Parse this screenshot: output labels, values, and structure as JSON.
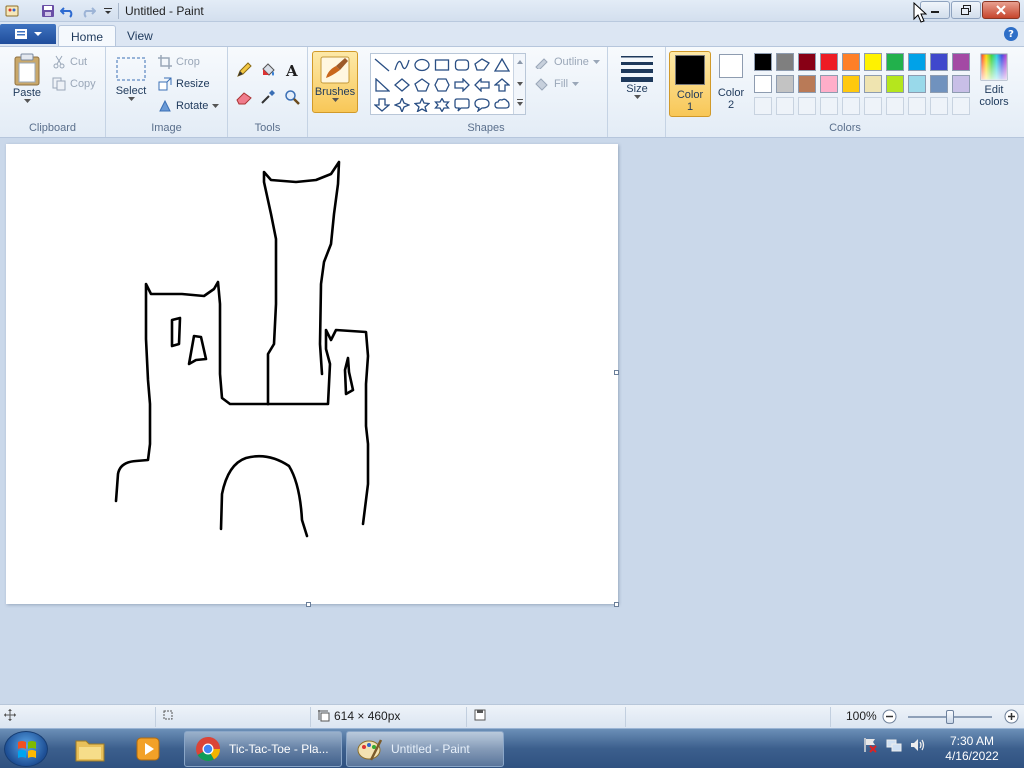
{
  "window": {
    "title": "Untitled - Paint"
  },
  "tabs": [
    {
      "label": "Home"
    },
    {
      "label": "View"
    }
  ],
  "clipboard": {
    "label": "Clipboard",
    "paste": "Paste",
    "cut": "Cut",
    "copy": "Copy"
  },
  "image": {
    "label": "Image",
    "select": "Select",
    "crop": "Crop",
    "resize": "Resize",
    "rotate": "Rotate"
  },
  "tools": {
    "label": "Tools"
  },
  "brushes": {
    "label": "Brushes"
  },
  "shapes": {
    "label": "Shapes",
    "outline": "Outline",
    "fill": "Fill"
  },
  "size": {
    "label": "Size"
  },
  "colors": {
    "label": "Colors",
    "color1_line1": "Color",
    "color1_line2": "1",
    "color2_line1": "Color",
    "color2_line2": "2",
    "edit_line1": "Edit",
    "edit_line2": "colors",
    "color1": "#000000",
    "color2": "#ffffff",
    "palette_row1": [
      "#000000",
      "#7f7f7f",
      "#880015",
      "#ed1c24",
      "#ff7f27",
      "#fff200",
      "#22b14c",
      "#00a2e8",
      "#3f48cc",
      "#a349a4"
    ],
    "palette_row2": [
      "#ffffff",
      "#c3c3c3",
      "#b97a57",
      "#ffaec9",
      "#ffc90e",
      "#efe4b0",
      "#b5e61d",
      "#99d9ea",
      "#7092be",
      "#c8bfe7"
    ]
  },
  "status": {
    "dimensions": "614 × 460px",
    "zoom": "100%"
  },
  "taskbar": {
    "chrome_task": "Tic-Tac-Toe - Pla...",
    "paint_task": "Untitled - Paint",
    "time": "7:30 AM",
    "date": "4/16/2022"
  }
}
